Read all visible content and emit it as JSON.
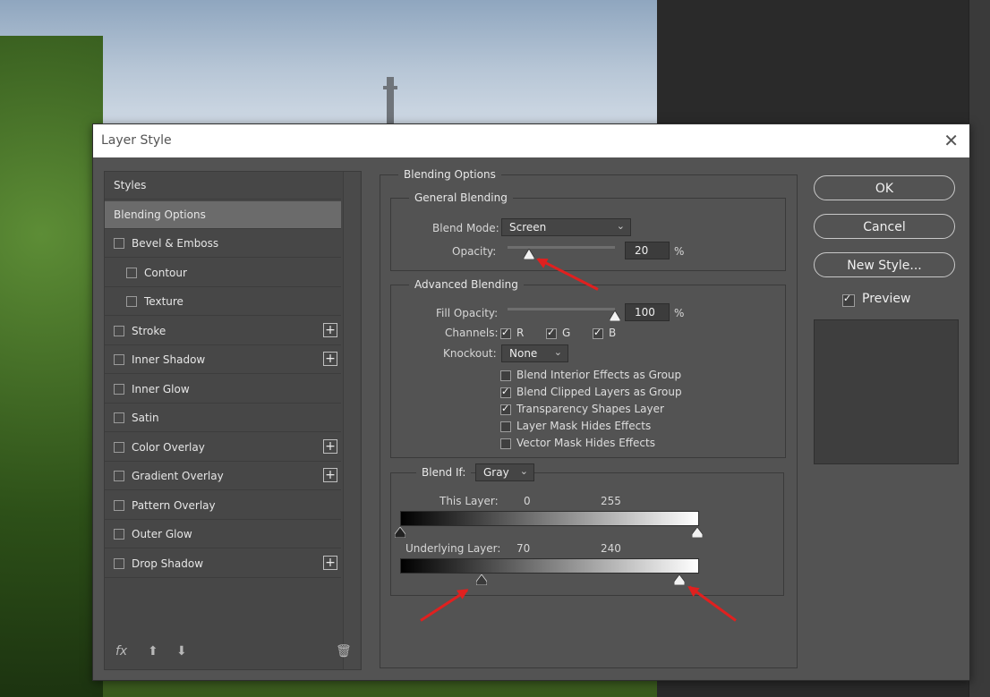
{
  "dialog": {
    "title": "Layer Style",
    "close_glyph": "✕"
  },
  "styles_list": {
    "header": "Styles",
    "items": [
      {
        "label": "Blending Options",
        "checkbox": false,
        "selected": true,
        "indent": false,
        "plus": false
      },
      {
        "label": "Bevel & Emboss",
        "checkbox": true,
        "checked": false,
        "indent": false,
        "plus": false
      },
      {
        "label": "Contour",
        "checkbox": true,
        "checked": false,
        "indent": true,
        "plus": false
      },
      {
        "label": "Texture",
        "checkbox": true,
        "checked": false,
        "indent": true,
        "plus": false
      },
      {
        "label": "Stroke",
        "checkbox": true,
        "checked": false,
        "indent": false,
        "plus": true
      },
      {
        "label": "Inner Shadow",
        "checkbox": true,
        "checked": false,
        "indent": false,
        "plus": true
      },
      {
        "label": "Inner Glow",
        "checkbox": true,
        "checked": false,
        "indent": false,
        "plus": false
      },
      {
        "label": "Satin",
        "checkbox": true,
        "checked": false,
        "indent": false,
        "plus": false
      },
      {
        "label": "Color Overlay",
        "checkbox": true,
        "checked": false,
        "indent": false,
        "plus": true
      },
      {
        "label": "Gradient Overlay",
        "checkbox": true,
        "checked": false,
        "indent": false,
        "plus": true
      },
      {
        "label": "Pattern Overlay",
        "checkbox": true,
        "checked": false,
        "indent": false,
        "plus": false
      },
      {
        "label": "Outer Glow",
        "checkbox": true,
        "checked": false,
        "indent": false,
        "plus": false
      },
      {
        "label": "Drop Shadow",
        "checkbox": true,
        "checked": false,
        "indent": false,
        "plus": true
      }
    ],
    "plus_glyph": "+",
    "fx_label": "fx",
    "up_glyph": "⬆",
    "down_glyph": "⬇",
    "trash_glyph": "🗑"
  },
  "blending": {
    "section_title": "Blending Options",
    "general": {
      "title": "General Blending",
      "blend_mode_label": "Blend Mode:",
      "blend_mode_value": "Screen",
      "opacity_label": "Opacity:",
      "opacity_value": "20",
      "opacity_unit": "%",
      "opacity_fraction": 0.2
    },
    "advanced": {
      "title": "Advanced Blending",
      "fill_opacity_label": "Fill Opacity:",
      "fill_opacity_value": "100",
      "fill_opacity_unit": "%",
      "fill_opacity_fraction": 1.0,
      "channels_label": "Channels:",
      "channels": [
        {
          "label": "R",
          "checked": true
        },
        {
          "label": "G",
          "checked": true
        },
        {
          "label": "B",
          "checked": true
        }
      ],
      "knockout_label": "Knockout:",
      "knockout_value": "None",
      "options": [
        {
          "label": "Blend Interior Effects as Group",
          "checked": false
        },
        {
          "label": "Blend Clipped Layers as Group",
          "checked": true
        },
        {
          "label": "Transparency Shapes Layer",
          "checked": true
        },
        {
          "label": "Layer Mask Hides Effects",
          "checked": false
        },
        {
          "label": "Vector Mask Hides Effects",
          "checked": false
        }
      ]
    },
    "blend_if": {
      "label": "Blend If:",
      "value": "Gray",
      "this_layer_label": "This Layer:",
      "this_layer_low": "0",
      "this_layer_high": "255",
      "underlying_label": "Underlying Layer:",
      "underlying_low": "70",
      "underlying_high": "240",
      "max": 255
    }
  },
  "buttons": {
    "ok": "OK",
    "cancel": "Cancel",
    "new_style": "New Style...",
    "preview_label": "Preview",
    "preview_checked": true
  },
  "colors": {
    "annotation_arrow": "#e0201f"
  }
}
